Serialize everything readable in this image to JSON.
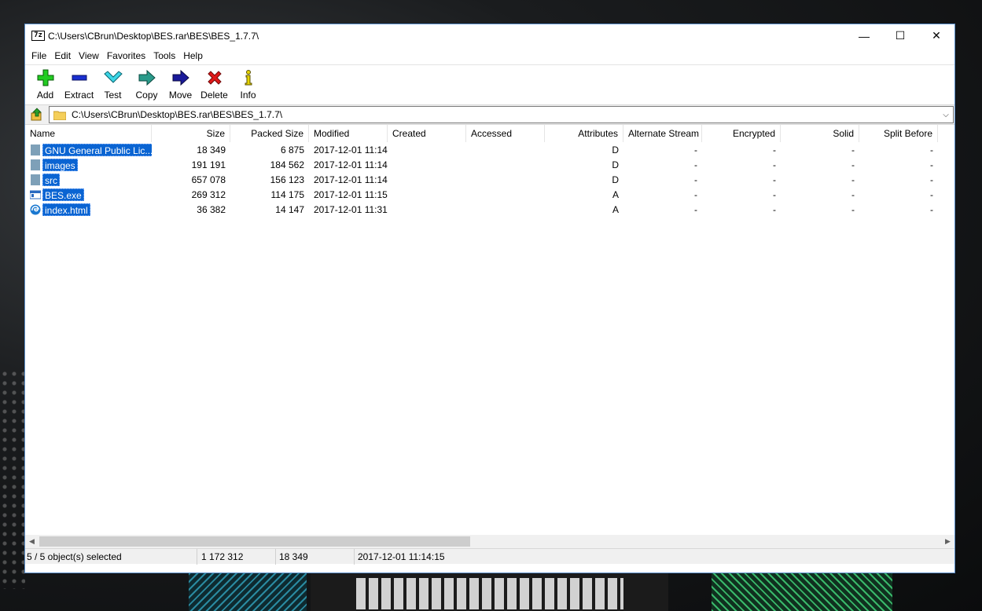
{
  "window": {
    "title": "C:\\Users\\CBrun\\Desktop\\BES.rar\\BES\\BES_1.7.7\\",
    "app_icon_text": "7z",
    "controls": {
      "minimize": "—",
      "maximize": "☐",
      "close": "✕"
    }
  },
  "menu": [
    "File",
    "Edit",
    "View",
    "Favorites",
    "Tools",
    "Help"
  ],
  "toolbar": [
    {
      "label": "Add",
      "icon": "add-icon"
    },
    {
      "label": "Extract",
      "icon": "extract-icon"
    },
    {
      "label": "Test",
      "icon": "test-icon"
    },
    {
      "label": "Copy",
      "icon": "copy-icon"
    },
    {
      "label": "Move",
      "icon": "move-icon"
    },
    {
      "label": "Delete",
      "icon": "delete-icon"
    },
    {
      "label": "Info",
      "icon": "info-icon"
    }
  ],
  "address": {
    "path": "C:\\Users\\CBrun\\Desktop\\BES.rar\\BES\\BES_1.7.7\\"
  },
  "columns": [
    "Name",
    "Size",
    "Packed Size",
    "Modified",
    "Created",
    "Accessed",
    "Attributes",
    "Alternate Stream",
    "Encrypted",
    "Solid",
    "Split Before"
  ],
  "files": [
    {
      "name": "GNU General Public Lic...",
      "size": "18 349",
      "packed": "6 875",
      "modified": "2017-12-01 11:14",
      "created": "",
      "accessed": "",
      "attributes": "D",
      "alt_stream": "-",
      "encrypted": "-",
      "solid": "-",
      "split_before": "-",
      "icon": "folder-icon"
    },
    {
      "name": "images",
      "size": "191 191",
      "packed": "184 562",
      "modified": "2017-12-01 11:14",
      "created": "",
      "accessed": "",
      "attributes": "D",
      "alt_stream": "-",
      "encrypted": "-",
      "solid": "-",
      "split_before": "-",
      "icon": "folder-icon"
    },
    {
      "name": "src",
      "size": "657 078",
      "packed": "156 123",
      "modified": "2017-12-01 11:14",
      "created": "",
      "accessed": "",
      "attributes": "D",
      "alt_stream": "-",
      "encrypted": "-",
      "solid": "-",
      "split_before": "-",
      "icon": "folder-icon"
    },
    {
      "name": "BES.exe",
      "size": "269 312",
      "packed": "114 175",
      "modified": "2017-12-01 11:15",
      "created": "",
      "accessed": "",
      "attributes": "A",
      "alt_stream": "-",
      "encrypted": "-",
      "solid": "-",
      "split_before": "-",
      "icon": "exe-icon"
    },
    {
      "name": "index.html",
      "size": "36 382",
      "packed": "14 147",
      "modified": "2017-12-01 11:31",
      "created": "",
      "accessed": "",
      "attributes": "A",
      "alt_stream": "-",
      "encrypted": "-",
      "solid": "-",
      "split_before": "-",
      "icon": "edge-html-icon"
    }
  ],
  "status": {
    "selected": "5 / 5 object(s) selected",
    "total_size": "1 172 312",
    "selected_size": "18 349",
    "modified": "2017-12-01 11:14:15"
  },
  "colors": {
    "selection": "#0a64d2",
    "window_border": "#5a8ec9"
  }
}
